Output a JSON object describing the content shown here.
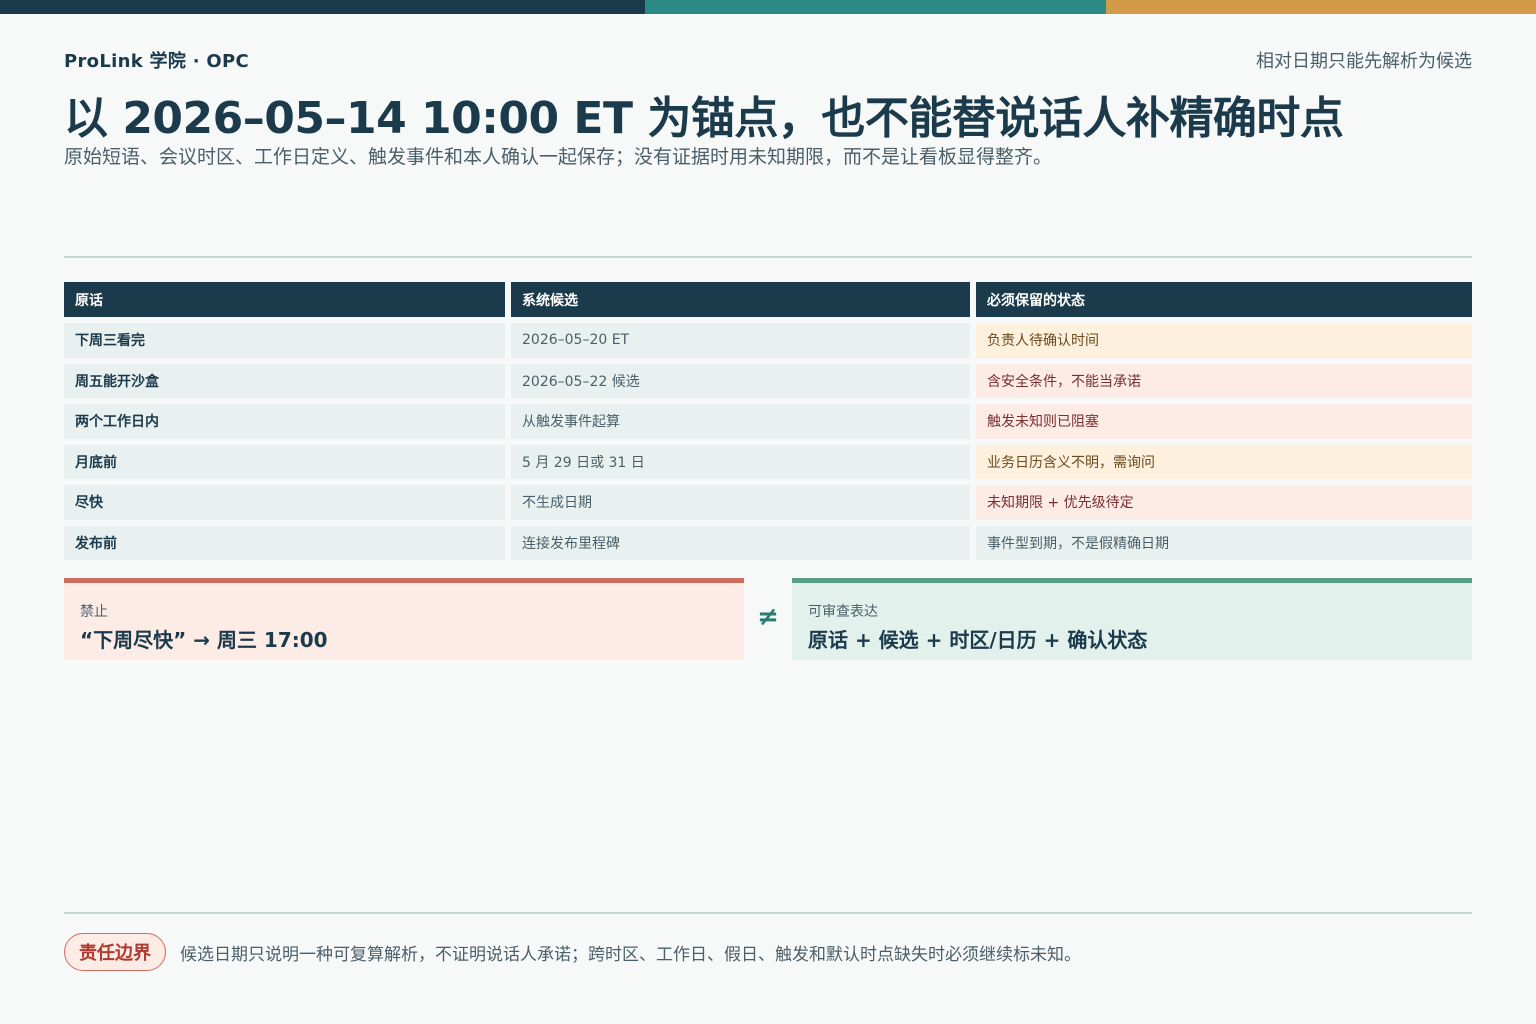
{
  "colors": {
    "navy": "#1b3a4b",
    "teal": "#2a8a86",
    "amber": "#d39a47",
    "rose": "#cf6e60",
    "green": "#5a9e86"
  },
  "header": {
    "brand": "ProLink 学院 · OPC",
    "tagline": "相对日期只能先解析为候选",
    "title": "以 2026–05–14 10:00 ET 为锚点，也不能替说话人补精确时点",
    "subtitle": "原始短语、会议时区、工作日定义、触发事件和本人确认一起保存；没有证据时用未知期限，而不是让看板显得整齐。"
  },
  "table": {
    "headers": [
      "原话",
      "系统候选",
      "必须保留的状态"
    ],
    "rows": [
      {
        "phrase": "下周三看完",
        "candidate": "2026–05–20 ET",
        "status": "负责人待确认时间",
        "tone": "amber"
      },
      {
        "phrase": "周五能开沙盒",
        "candidate": "2026–05–22 候选",
        "status": "含安全条件，不能当承诺",
        "tone": "rose"
      },
      {
        "phrase": "两个工作日内",
        "candidate": "从触发事件起算",
        "status": "触发未知则已阻塞",
        "tone": "rose"
      },
      {
        "phrase": "月底前",
        "candidate": "5 月 29 日或 31 日",
        "status": "业务日历含义不明，需询问",
        "tone": "amber"
      },
      {
        "phrase": "尽快",
        "candidate": "不生成日期",
        "status": "未知期限 + 优先级待定",
        "tone": "rose"
      },
      {
        "phrase": "发布前",
        "candidate": "连接发布里程碑",
        "status": "事件型到期，不是假精确日期",
        "tone": "neutral"
      }
    ]
  },
  "compare": {
    "bad_label": "禁止",
    "bad_text": "“下周尽快” → 周三 17:00",
    "symbol": "≠",
    "good_label": "可审查表达",
    "good_text": "原话 + 候选 + 时区/日历 + 确认状态"
  },
  "footer": {
    "badge": "责任边界",
    "text": "候选日期只说明一种可复算解析，不证明说话人承诺；跨时区、工作日、假日、触发和默认时点缺失时必须继续标未知。"
  }
}
